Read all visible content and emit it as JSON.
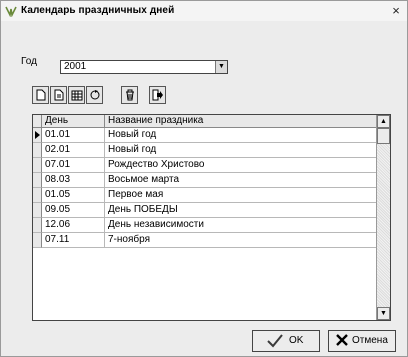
{
  "window": {
    "title": "Календарь праздничных дней",
    "close": "×"
  },
  "year": {
    "label": "Год",
    "value": "2001"
  },
  "toolbar": {
    "icons": [
      "new-doc-icon",
      "copy-doc-icon",
      "calendar-grid-icon",
      "refresh-icon",
      "trash-icon",
      "export-icon"
    ]
  },
  "grid": {
    "columns": [
      "День",
      "Название праздника"
    ],
    "rows": [
      {
        "day": "01.01",
        "name": "Новый год"
      },
      {
        "day": "02.01",
        "name": "Новый год"
      },
      {
        "day": "07.01",
        "name": "Рождество Христово"
      },
      {
        "day": "08.03",
        "name": "Восьмое марта"
      },
      {
        "day": "01.05",
        "name": "Первое мая"
      },
      {
        "day": "09.05",
        "name": "День ПОБЕДЫ"
      },
      {
        "day": "12.06",
        "name": "День независимости"
      },
      {
        "day": "07.11",
        "name": "7-ноября"
      }
    ]
  },
  "buttons": {
    "ok": "OK",
    "cancel": "Отмена"
  }
}
